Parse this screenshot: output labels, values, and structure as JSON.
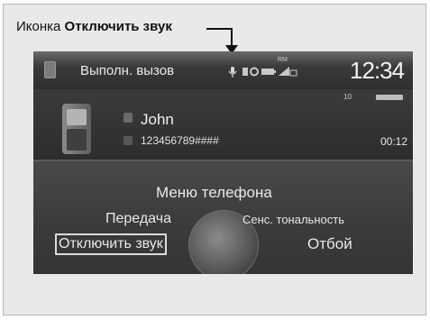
{
  "callout": {
    "prefix": "Иконка",
    "target": "Отключить звук"
  },
  "status_bar": {
    "call_status": "Выполн. вызов",
    "network_label": "RM",
    "clock": "12:34",
    "icons": [
      "phone-icon",
      "microphone-muted-icon",
      "bluetooth-icon",
      "hfl-icon",
      "battery-icon",
      "signal-icon"
    ]
  },
  "call_info": {
    "sub_status": "10",
    "contact_name": "John",
    "phone_number": "123456789####",
    "duration": "00:12"
  },
  "menu": {
    "title": "Меню телефона",
    "transfer": "Передача",
    "touch_tones": "Сенс. тональность",
    "mute": "Отключить звук",
    "end_call": "Отбой",
    "selected": "Отключить звук"
  }
}
